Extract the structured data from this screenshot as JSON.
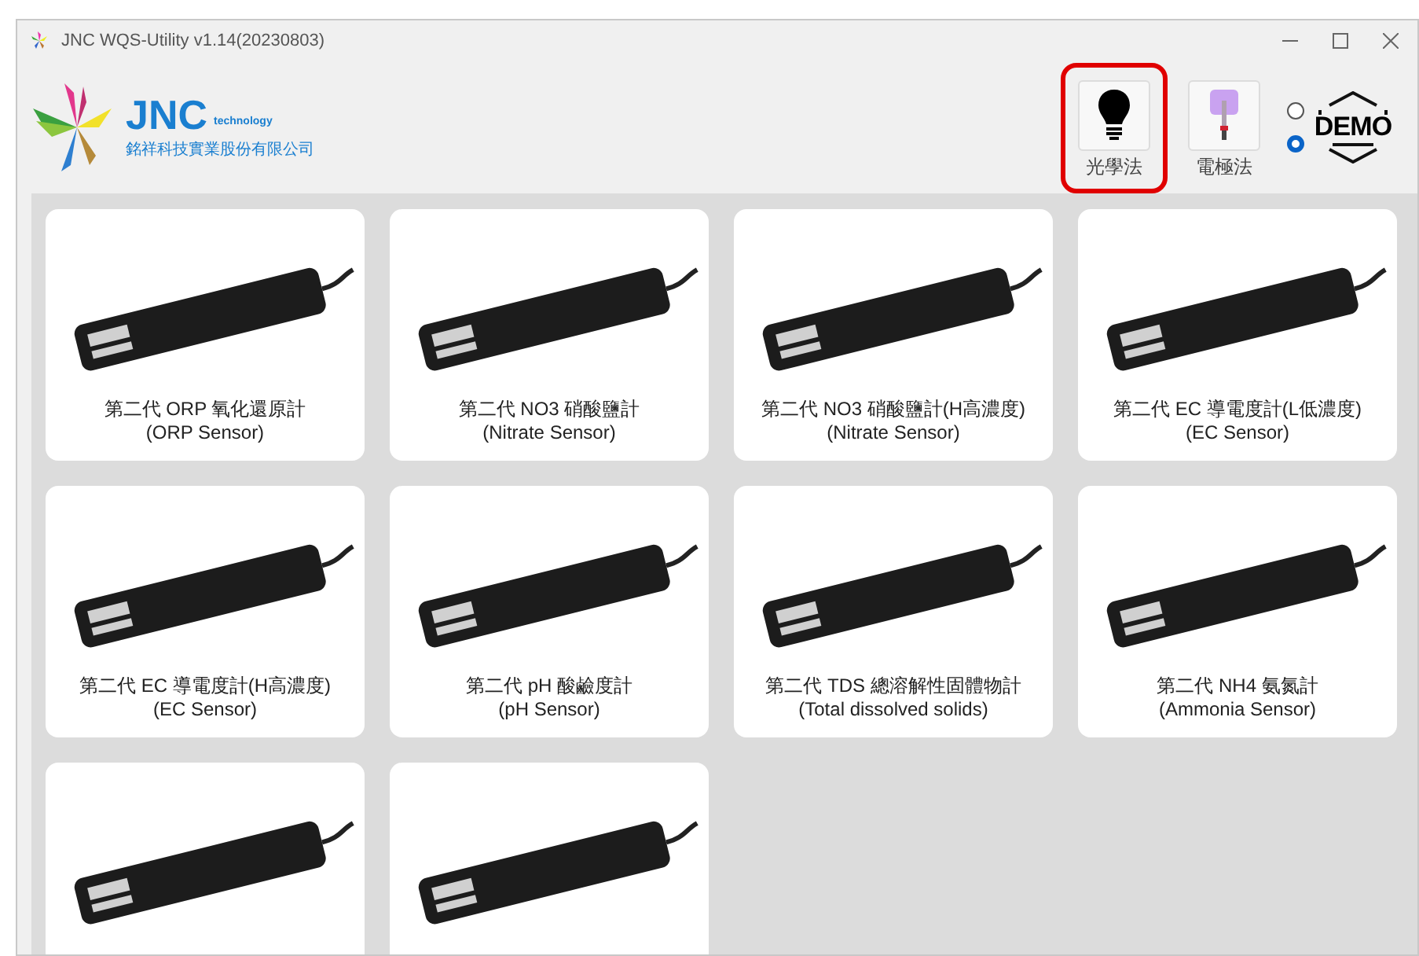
{
  "window": {
    "title": "JNC WQS-Utility v1.14(20230803)"
  },
  "logo": {
    "name": "JNC",
    "tagline": "technology",
    "company": "銘祥科技實業股份有限公司"
  },
  "modes": [
    {
      "kind": "optical",
      "label": "光學法",
      "selected": true
    },
    {
      "kind": "electrode",
      "label": "電極法",
      "selected": false
    }
  ],
  "radios": [
    {
      "selected": false
    },
    {
      "selected": true
    }
  ],
  "demo": {
    "label": "DEMO"
  },
  "sensors": [
    {
      "kind": "labeled",
      "title": "第二代 ORP 氧化還原計",
      "subtitle": "(ORP Sensor)"
    },
    {
      "kind": "labeled",
      "title": "第二代 NO3 硝酸鹽計",
      "subtitle": "(Nitrate Sensor)"
    },
    {
      "kind": "labeled",
      "title": "第二代 NO3 硝酸鹽計(H高濃度)",
      "subtitle": "(Nitrate Sensor)"
    },
    {
      "kind": "labeled",
      "title": "第二代 EC 導電度計(L低濃度)",
      "subtitle": "(EC Sensor)"
    },
    {
      "kind": "labeled",
      "title": "第二代 EC 導電度計(H高濃度)",
      "subtitle": "(EC Sensor)"
    },
    {
      "kind": "labeled",
      "title": "第二代 pH 酸鹼度計",
      "subtitle": "(pH Sensor)"
    },
    {
      "kind": "labeled",
      "title": "第二代 TDS 總溶解性固體物計",
      "subtitle": "(Total dissolved solids)"
    },
    {
      "kind": "labeled",
      "title": "第二代 NH4 氨氮計",
      "subtitle": "(Ammonia Sensor)"
    },
    {
      "kind": "cut_off"
    },
    {
      "kind": "cut_off"
    }
  ]
}
